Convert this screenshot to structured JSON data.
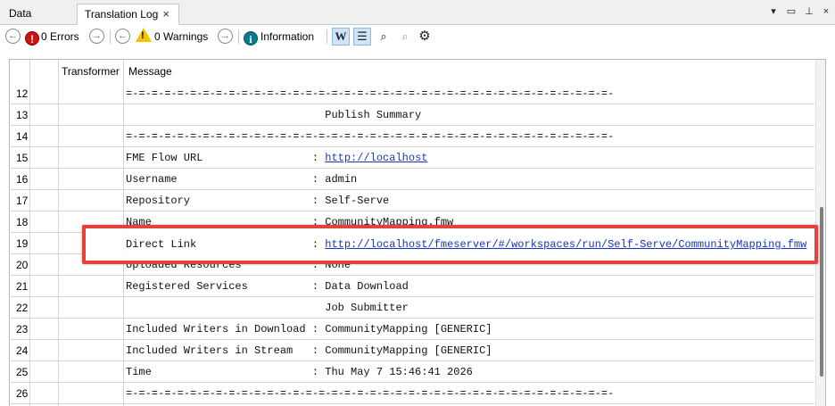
{
  "tabs": [
    {
      "label": "Data Preview",
      "active": false
    },
    {
      "label": "Translation Log",
      "active": true,
      "close": "×"
    }
  ],
  "window_controls": [
    "▾",
    "▭",
    "⊥",
    "×"
  ],
  "toolbar": {
    "errors_label": "0 Errors",
    "warnings_label": "0 Warnings",
    "information_label": "Information",
    "icons": [
      "back-icon",
      "error-icon",
      "forward-icon",
      "back-icon",
      "warning-icon",
      "forward-icon",
      "info-icon",
      "word-wrap-icon",
      "list-icon",
      "find-icon",
      "find-next-icon",
      "settings-icon"
    ]
  },
  "columns": [
    "Transformer",
    "Message"
  ],
  "rows": [
    {
      "num": "12",
      "msg": "=-=-=-=-=-=-=-=-=-=-=-=-=-=-=-=-=-=-=-=-=-=-=-=-=-=-=-=-=-=-=-=-=-=-=-=-=-=-"
    },
    {
      "num": "13",
      "msg": "                               Publish Summary"
    },
    {
      "num": "14",
      "msg": "=-=-=-=-=-=-=-=-=-=-=-=-=-=-=-=-=-=-=-=-=-=-=-=-=-=-=-=-=-=-=-=-=-=-=-=-=-=-"
    },
    {
      "num": "15",
      "msg": "FME Flow URL                 : ",
      "link": "http://localhost"
    },
    {
      "num": "16",
      "msg": "Username                     : admin"
    },
    {
      "num": "17",
      "msg": "Repository                   : Self-Serve"
    },
    {
      "num": "18",
      "msg": "Name                         : CommunityMapping.fmw"
    },
    {
      "num": "19",
      "msg": "Direct Link                  : ",
      "link": "http://localhost/fmeserver/#/workspaces/run/Self-Serve/CommunityMapping.fmw"
    },
    {
      "num": "20",
      "msg": "Uploaded Resources           : None"
    },
    {
      "num": "21",
      "msg": "Registered Services          : Data Download"
    },
    {
      "num": "22",
      "msg": "                               Job Submitter"
    },
    {
      "num": "23",
      "msg": "Included Writers in Download : CommunityMapping [GENERIC]"
    },
    {
      "num": "24",
      "msg": "Included Writers in Stream   : CommunityMapping [GENERIC]"
    },
    {
      "num": "25",
      "msg": "Time                         : Thu May 7 15:46:41 2026"
    },
    {
      "num": "26",
      "msg": "=-=-=-=-=-=-=-=-=-=-=-=-=-=-=-=-=-=-=-=-=-=-=-=-=-=-=-=-=-=-=-=-=-=-=-=-=-=-"
    }
  ],
  "highlight": {
    "label": "Direct Link                  : ",
    "link": "http://localhost/fmeserver/#/workspaces/run/Self-Serve/CommunityMapping.fmw",
    "color": "#e8403a"
  },
  "colors": {
    "link": "#1a39b8",
    "error": "#d01111",
    "warning": "#f5c400",
    "info": "#0d7a8c",
    "highlight": "#e8403a"
  }
}
